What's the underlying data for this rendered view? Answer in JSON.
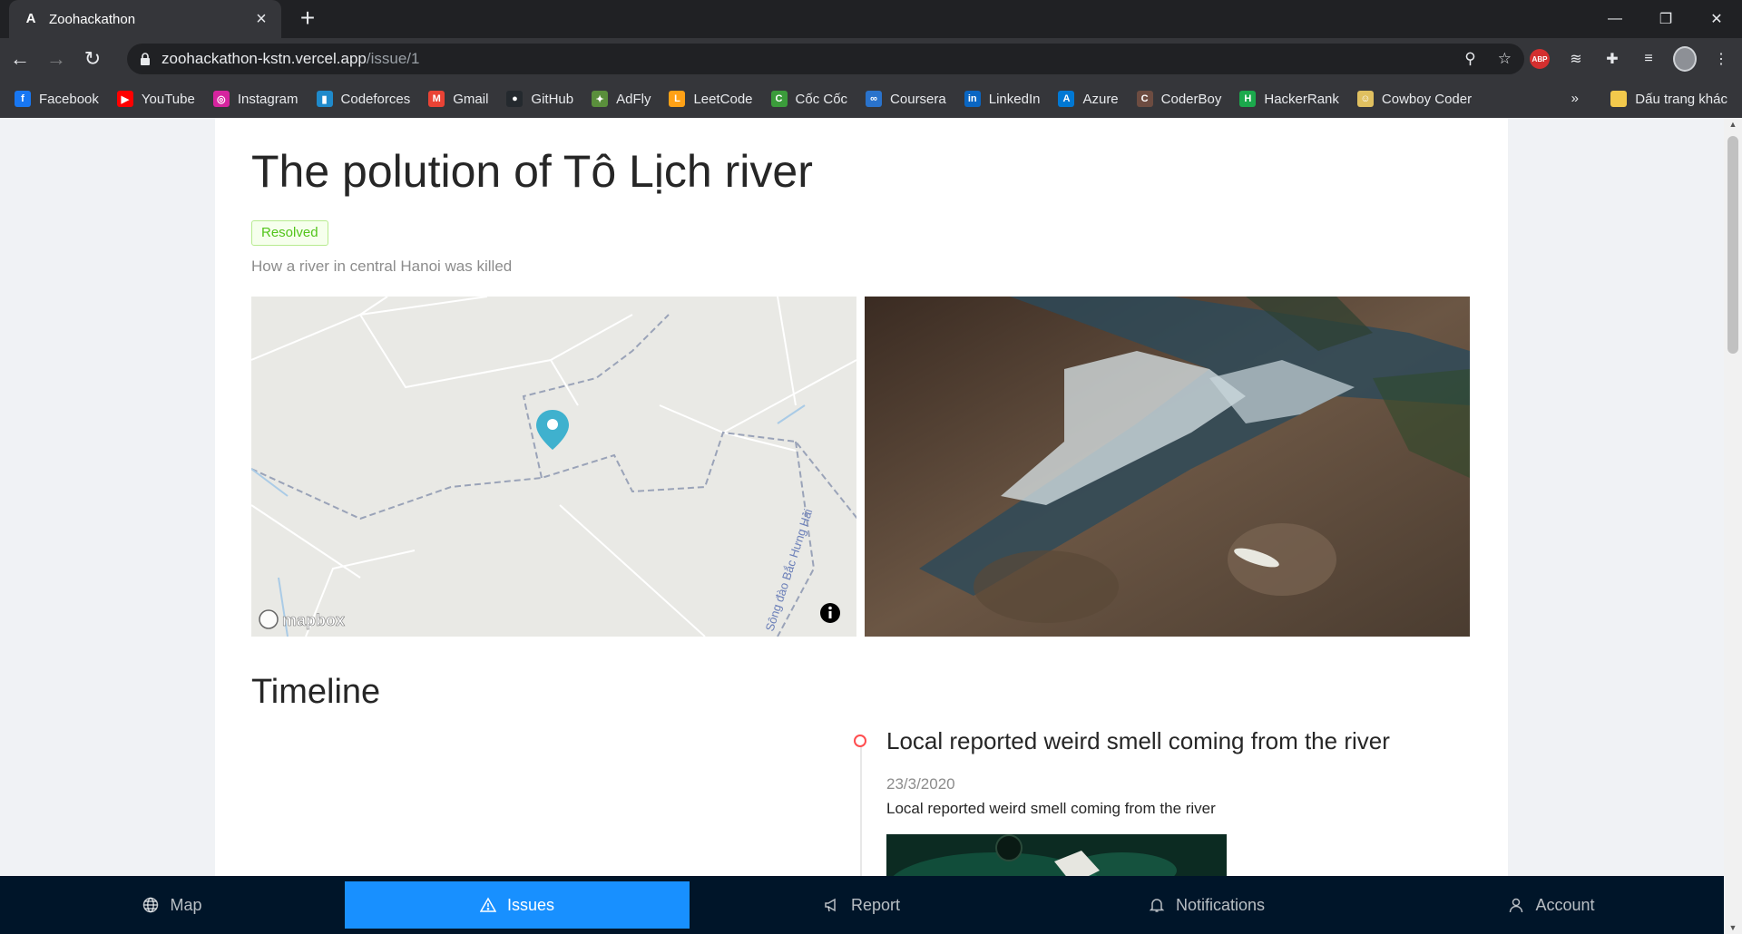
{
  "browser": {
    "tab_title": "Zoohackathon",
    "tab_favicon": "A",
    "url_host": "zoohackathon-kstn.vercel.app",
    "url_path": "/issue/1",
    "bookmarks": [
      {
        "label": "Facebook",
        "icon": "facebook-icon",
        "color": "#1877f2",
        "glyph": "f"
      },
      {
        "label": "YouTube",
        "icon": "youtube-icon",
        "color": "#ff0000",
        "glyph": "▶"
      },
      {
        "label": "Instagram",
        "icon": "instagram-icon",
        "color": "#d6249f",
        "glyph": "◎"
      },
      {
        "label": "Codeforces",
        "icon": "codeforces-icon",
        "color": "#1f8acb",
        "glyph": "▮"
      },
      {
        "label": "Gmail",
        "icon": "gmail-icon",
        "color": "#ea4335",
        "glyph": "M"
      },
      {
        "label": "GitHub",
        "icon": "github-icon",
        "color": "#24292e",
        "glyph": "●"
      },
      {
        "label": "AdFly",
        "icon": "adfly-icon",
        "color": "#5a8f3c",
        "glyph": "✦"
      },
      {
        "label": "LeetCode",
        "icon": "leetcode-icon",
        "color": "#ffa116",
        "glyph": "L"
      },
      {
        "label": "Cốc Cốc",
        "icon": "coccoc-icon",
        "color": "#3b9c3b",
        "glyph": "C"
      },
      {
        "label": "Coursera",
        "icon": "coursera-icon",
        "color": "#2a73cc",
        "glyph": "∞"
      },
      {
        "label": "LinkedIn",
        "icon": "linkedin-icon",
        "color": "#0a66c2",
        "glyph": "in"
      },
      {
        "label": "Azure",
        "icon": "azure-icon",
        "color": "#0078d4",
        "glyph": "A"
      },
      {
        "label": "CoderBoy",
        "icon": "coderboy-icon",
        "color": "#6d4c41",
        "glyph": "C"
      },
      {
        "label": "HackerRank",
        "icon": "hackerrank-icon",
        "color": "#1ba94c",
        "glyph": "H"
      },
      {
        "label": "Cowboy Coder",
        "icon": "cowboy-coder-icon",
        "color": "#e0c060",
        "glyph": "☺"
      }
    ],
    "bookmarks_more": "»",
    "other_bookmarks": "Dấu trang khác"
  },
  "issue": {
    "title": "The polution of Tô Lịch river",
    "status": "Resolved",
    "subtitle": "How a river in central Hanoi was killed",
    "map_label": "Sông đào Bắc Hưng Hải",
    "map_logo": "mapbox"
  },
  "timeline": {
    "heading": "Timeline",
    "items": [
      {
        "title": "Local reported weird smell coming from the river",
        "date": "23/3/2020",
        "description": "Local reported weird smell coming from the river"
      }
    ]
  },
  "nav": {
    "items": [
      {
        "label": "Map",
        "icon": "globe-icon"
      },
      {
        "label": "Issues",
        "icon": "warning-icon",
        "active": true
      },
      {
        "label": "Report",
        "icon": "megaphone-icon"
      },
      {
        "label": "Notifications",
        "icon": "bell-icon"
      },
      {
        "label": "Account",
        "icon": "user-icon"
      }
    ]
  },
  "colors": {
    "accent": "#1890ff",
    "nav_bg": "#001529",
    "resolved": "#52c41a",
    "timeline_dot": "#ff4d4f"
  }
}
